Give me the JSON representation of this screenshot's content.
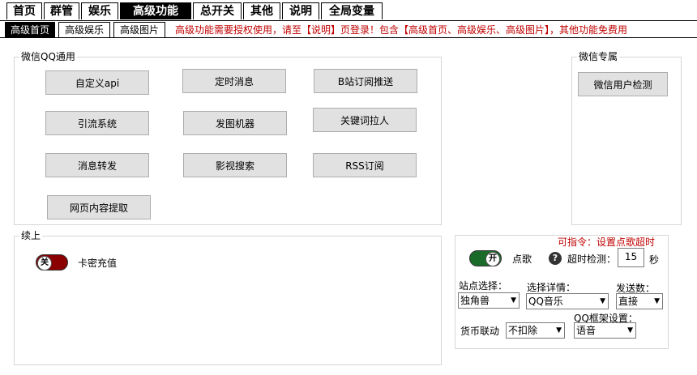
{
  "tabs": [
    "首页",
    "群管",
    "娱乐",
    "高级功能",
    "总开关",
    "其他",
    "说明",
    "全局变量"
  ],
  "subtabs": [
    "高级首页",
    "高级娱乐",
    "高级图片"
  ],
  "notice": "高级功能需要授权使用，请至【说明】页登录！包含【高级首页、高级娱乐、高级图片】，其他功能免费用",
  "wechat_qq": {
    "title": "微信QQ通用",
    "buttons": [
      "自定义api",
      "定时消息",
      "B站订阅推送",
      "引流系统",
      "发图机器",
      "关键词拉人",
      "消息转发",
      "影视搜索",
      "RSS订阅",
      "网页内容提取"
    ]
  },
  "wechat_only": {
    "title": "微信专属",
    "button": "微信用户检测"
  },
  "continue": {
    "title": "续上",
    "toggle_text": "关",
    "label": "卡密充值"
  },
  "music": {
    "command_hint": "可指令：设置点歌超时",
    "toggle_text": "开",
    "label": "点歌",
    "help": "?",
    "timeout_label": "超时检测：",
    "timeout_value": "15",
    "timeout_unit": "秒",
    "site_label": "站点选择：",
    "site_value": "独角兽",
    "detail_label": "选择详情：",
    "detail_value": "QQ音乐",
    "send_label": "发送数：",
    "send_value": "直接",
    "frame_label": "QQ框架设置：",
    "frame_value": "语音",
    "coin_label": "货币联动",
    "coin_value": "不扣除"
  },
  "colors": {
    "notice": "#c00000",
    "toggle_on": "#1a6b2a",
    "toggle_off": "#8b0000"
  }
}
